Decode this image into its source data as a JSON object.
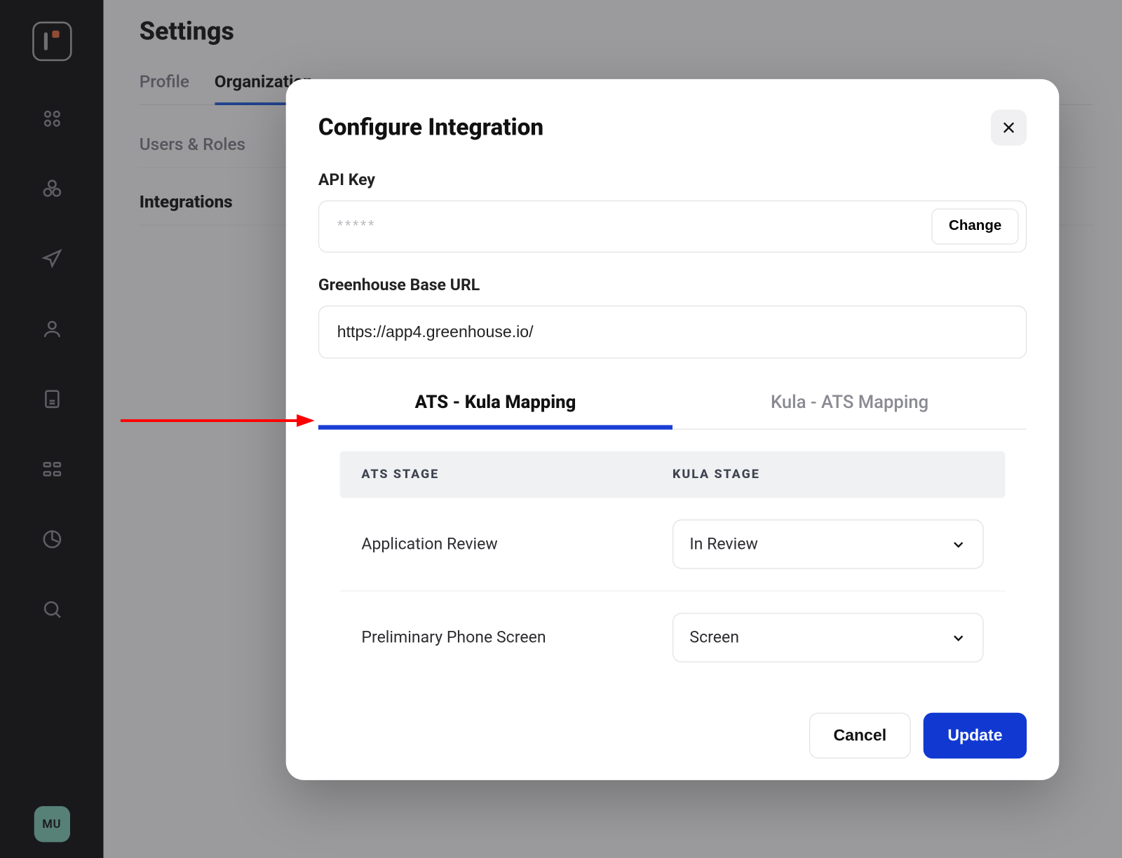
{
  "page": {
    "title": "Settings",
    "tabs": [
      {
        "label": "Profile",
        "active": false
      },
      {
        "label": "Organization",
        "active": true
      }
    ],
    "subnav": [
      {
        "label": "Users & Roles",
        "active": false
      },
      {
        "label": "Integrations",
        "active": true
      }
    ]
  },
  "avatar": {
    "initials": "MU"
  },
  "modal": {
    "title": "Configure Integration",
    "api_key": {
      "label": "API Key",
      "placeholder": "*****",
      "change_btn": "Change"
    },
    "base_url": {
      "label": "Greenhouse Base URL",
      "value": "https://app4.greenhouse.io/"
    },
    "mapping_tabs": [
      {
        "label": "ATS - Kula Mapping",
        "active": true
      },
      {
        "label": "Kula - ATS Mapping",
        "active": false
      }
    ],
    "table": {
      "th_left": "ATS STAGE",
      "th_right": "KULA STAGE",
      "rows": [
        {
          "ats": "Application Review",
          "kula": "In Review"
        },
        {
          "ats": "Preliminary Phone Screen",
          "kula": "Screen"
        }
      ]
    },
    "footer": {
      "cancel": "Cancel",
      "update": "Update"
    }
  }
}
